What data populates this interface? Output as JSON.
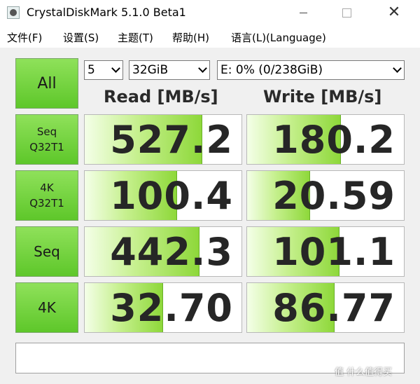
{
  "window": {
    "title": "CrystalDiskMark 5.1.0 Beta1",
    "close_glyph": "✕"
  },
  "menu": {
    "items": [
      "文件(F)",
      "设置(S)",
      "主题(T)",
      "帮助(H)",
      "语言(L)(Language)"
    ]
  },
  "controls": {
    "all_label": "All",
    "count_value": "5",
    "size_value": "32GiB",
    "drive_value": "E: 0% (0/238GiB)"
  },
  "headers": {
    "read": "Read [MB/s]",
    "write": "Write [MB/s]"
  },
  "rows": [
    {
      "label_line1": "Seq",
      "label_line2": "Q32T1",
      "read": "527.2",
      "write": "180.2",
      "read_fill": 0.75,
      "write_fill": 0.6
    },
    {
      "label_line1": "4K",
      "label_line2": "Q32T1",
      "read": "100.4",
      "write": "20.59",
      "read_fill": 0.59,
      "write_fill": 0.4
    },
    {
      "label_line1": "Seq",
      "label_line2": "",
      "read": "442.3",
      "write": "101.1",
      "read_fill": 0.73,
      "write_fill": 0.59
    },
    {
      "label_line1": "4K",
      "label_line2": "",
      "read": "32.70",
      "write": "86.77",
      "read_fill": 0.5,
      "write_fill": 0.56
    }
  ],
  "status_text": "",
  "watermark": "值 什么值得买",
  "colors": {
    "accent_green": "#5ec72a",
    "bar_green": "#8ed83a"
  }
}
